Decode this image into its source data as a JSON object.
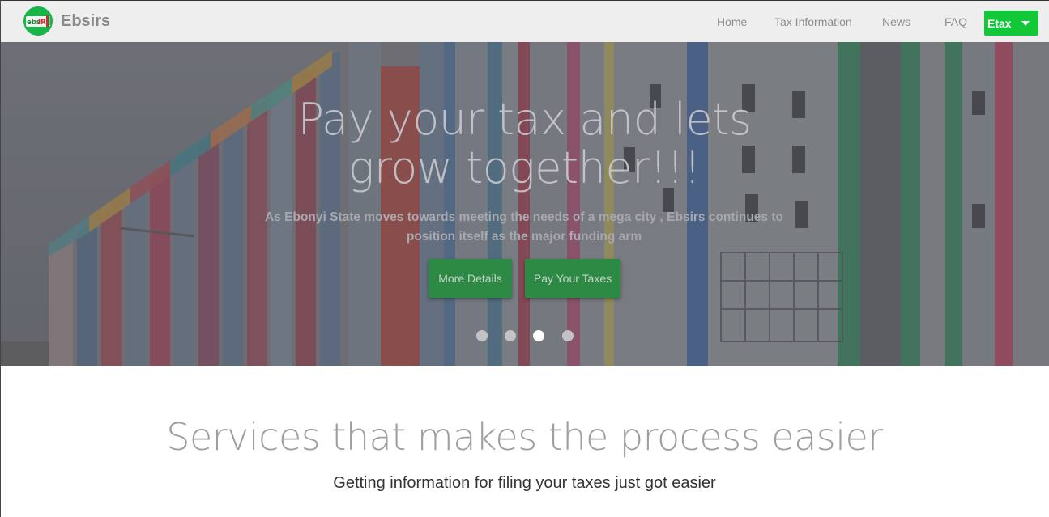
{
  "navbar": {
    "brand": "Ebsirs",
    "links": [
      "Home",
      "Tax Information",
      "News",
      "FAQ"
    ],
    "etax_label": "Etax",
    "etax_color": "#12c738"
  },
  "hero": {
    "title_line1": "Pay your tax and lets",
    "title_line2": "grow together!!!",
    "subtitle": "As Ebonyi State moves towards meeting the needs of a mega city , Ebsirs continues to position itself as the major funding arm",
    "buttons": [
      "More Details",
      "Pay Your Taxes"
    ],
    "button_color": "#2d8a45",
    "slides_count": 4,
    "active_slide": 3
  },
  "services": {
    "title": "Services that makes the process easier",
    "subtitle": "Getting information for filing your taxes just got easier"
  },
  "icons": {
    "logo": "ebsirs-logo-icon",
    "dropdown": "caret-down-icon"
  }
}
